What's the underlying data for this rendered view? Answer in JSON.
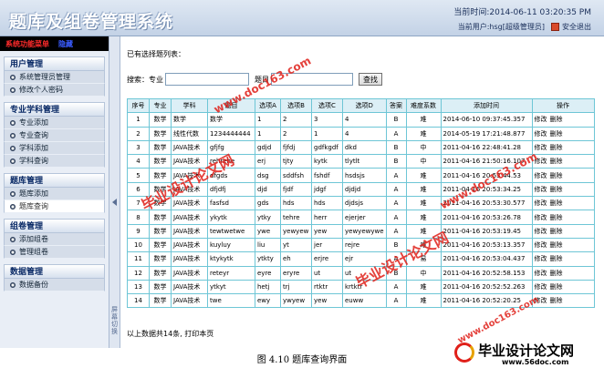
{
  "header": {
    "title": "题库及组卷管理系统",
    "time_label": "当前时间:2014-06-11 03:20:35 PM",
    "user_label": "当前用户:hsg[超级管理员]",
    "logout_label": "安全退出"
  },
  "sidebar": {
    "top_left": "系统功能菜单",
    "top_right": "隐藏",
    "groups": [
      {
        "title": "用户管理",
        "items": [
          "系统管理员管理",
          "修改个人密码"
        ]
      },
      {
        "title": "专业学科管理",
        "items": [
          "专业添加",
          "专业查询",
          "学科添加",
          "学科查询"
        ]
      },
      {
        "title": "题库管理",
        "items": [
          "题库添加",
          "题库查询"
        ]
      },
      {
        "title": "组卷管理",
        "items": [
          "添加组卷",
          "管理组卷"
        ]
      },
      {
        "title": "数据管理",
        "items": [
          "数据备份"
        ]
      }
    ],
    "splitter_label": "屏幕切换"
  },
  "main": {
    "list_title": "已有选择题列表：",
    "search": {
      "label_major": "搜索：专业",
      "label_title": "题目",
      "button": "查找"
    },
    "columns": [
      "序号",
      "专业",
      "学科",
      "题目",
      "选项A",
      "选项B",
      "选项C",
      "选项D",
      "答案",
      "难度系数",
      "添加时间",
      "操作"
    ],
    "rows": [
      [
        "1",
        "数学",
        "数学",
        "数学",
        "1",
        "2",
        "3",
        "4",
        "B",
        "难",
        "2014-06-10 09:37:45.357"
      ],
      [
        "2",
        "数学",
        "线性代数",
        "1234444444",
        "1",
        "2",
        "1",
        "4",
        "A",
        "难",
        "2014-05-19 17:21:48.877"
      ],
      [
        "3",
        "数学",
        "JAVA技术",
        "gfjfg",
        "gdjd",
        "fjfdj",
        "gdfkgdf",
        "dkd",
        "B",
        "中",
        "2011-04-16 22:48:41.28"
      ],
      [
        "4",
        "数学",
        "JAVA技术",
        "rehrehe",
        "erj",
        "tjty",
        "kytk",
        "tlytlt",
        "B",
        "中",
        "2011-04-16 21:50:16.107"
      ],
      [
        "5",
        "数学",
        "JAVA技术",
        "dfgds",
        "dsg",
        "sddfsh",
        "fshdf",
        "hsdsjs",
        "A",
        "难",
        "2011-04-16 20:53:44.53"
      ],
      [
        "6",
        "数学",
        "JAVA技术",
        "dfjdfj",
        "djd",
        "fjdf",
        "jdgf",
        "djdjd",
        "A",
        "难",
        "2011-04-16 20:53:34.25"
      ],
      [
        "7",
        "数学",
        "JAVA技术",
        "fasfsd",
        "gds",
        "hds",
        "hds",
        "djdsjs",
        "A",
        "难",
        "2011-04-16 20:53:30.577"
      ],
      [
        "8",
        "数学",
        "JAVA技术",
        "ykytk",
        "ytky",
        "tehre",
        "herr",
        "ejerjer",
        "A",
        "难",
        "2011-04-16 20:53:26.78"
      ],
      [
        "9",
        "数学",
        "JAVA技术",
        "tewtwetwe",
        "ywe",
        "yewyew",
        "yew",
        "yewyewywe",
        "A",
        "难",
        "2011-04-16 20:53:19.45"
      ],
      [
        "10",
        "数学",
        "JAVA技术",
        "kuyluy",
        "liu",
        "yt",
        "jer",
        "rejre",
        "B",
        "难",
        "2011-04-16 20:53:13.357"
      ],
      [
        "11",
        "数学",
        "JAVA技术",
        "ktykytk",
        "ytkty",
        "eh",
        "erjre",
        "ejr",
        "A",
        "易",
        "2011-04-16 20:53:04.437"
      ],
      [
        "12",
        "数学",
        "JAVA技术",
        "reteyr",
        "eyre",
        "eryre",
        "ut",
        "ut",
        "B",
        "中",
        "2011-04-16 20:52:58.153"
      ],
      [
        "13",
        "数学",
        "JAVA技术",
        "ytkyt",
        "hetj",
        "trj",
        "rtktr",
        "krtktr",
        "A",
        "难",
        "2011-04-16 20:52:52.263"
      ],
      [
        "14",
        "数学",
        "JAVA技术",
        "twe",
        "ewy",
        "ywyew",
        "yew",
        "euww",
        "A",
        "难",
        "2011-04-16 20:52:20.25"
      ]
    ],
    "ops": [
      "修改",
      "删除"
    ],
    "footer": "以上数据共14条, 打印本页"
  },
  "caption": "图 4.10 题库查询界面",
  "watermarks": {
    "cn": "毕业设计论文网",
    "url": "www.doc163.com",
    "logo_text": "毕业设计论文网",
    "logo_url": "www.56doc.com"
  },
  "colors": {
    "accent_red": "#e0201a",
    "table_border": "#6ec6d6",
    "header_bg": "#c3d2e6"
  }
}
